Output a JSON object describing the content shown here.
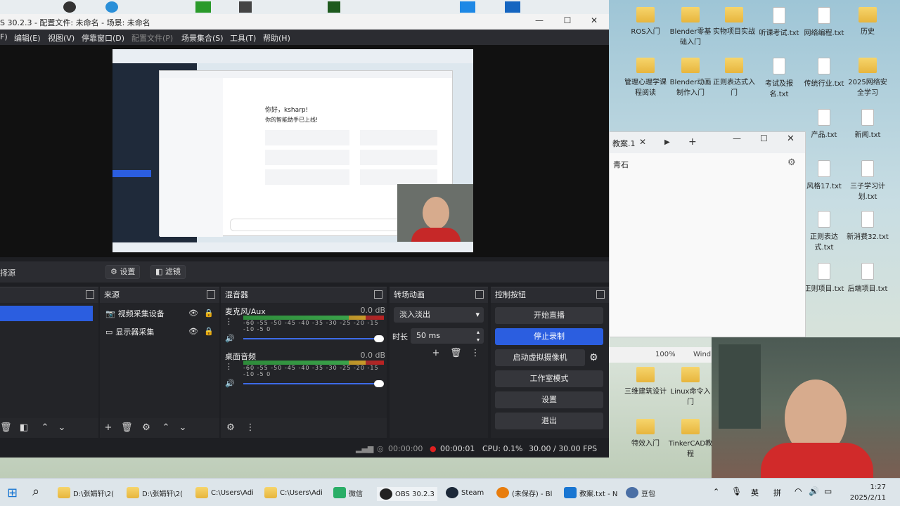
{
  "desktop_icons": [
    {
      "label": "ROS入门",
      "type": "folder"
    },
    {
      "label": "Blender零基础入门",
      "type": "folder"
    },
    {
      "label": "实物项目实战",
      "type": "folder"
    },
    {
      "label": "听课考试.txt",
      "type": "doc"
    },
    {
      "label": "网络编程.txt",
      "type": "doc"
    },
    {
      "label": "历史",
      "type": "folder"
    },
    {
      "label": "管理心理学课程阅读",
      "type": "folder"
    },
    {
      "label": "Blender动画制作入门",
      "type": "folder"
    },
    {
      "label": "正则表达式入门",
      "type": "folder"
    },
    {
      "label": "考试及报名.txt",
      "type": "doc"
    },
    {
      "label": "传统行业.txt",
      "type": "doc"
    },
    {
      "label": "2025网络安全学习",
      "type": "folder"
    },
    {
      "label": "产品.txt",
      "type": "doc"
    },
    {
      "label": "新闻.txt",
      "type": "doc"
    },
    {
      "label": "风格17.txt",
      "type": "doc"
    },
    {
      "label": "三子学习计划.txt",
      "type": "doc"
    },
    {
      "label": "正则表达式.txt",
      "type": "doc"
    },
    {
      "label": "新消费32.txt",
      "type": "doc"
    },
    {
      "label": "正则项目.txt",
      "type": "doc"
    },
    {
      "label": "后端项目.txt",
      "type": "doc"
    },
    {
      "label": "三维建筑设计",
      "type": "folder"
    },
    {
      "label": "Linux命令入门",
      "type": "folder"
    },
    {
      "label": "特效入门",
      "type": "folder"
    },
    {
      "label": "TinkerCAD教程",
      "type": "folder"
    }
  ],
  "obs": {
    "title": "S 30.2.3 - 配置文件: 未命名 - 场景: 未命名",
    "menu": [
      "F)",
      "编辑(E)",
      "视图(V)",
      "停靠窗口(D)",
      "配置文件(P)",
      "场景集合(S)",
      "工具(T)",
      "帮助(H)"
    ],
    "preview": {
      "greeting": "你好，ksharp!",
      "subtitle": "你的智能助手已上线!"
    },
    "toolbar": {
      "source_label": "择源",
      "settings": "设置",
      "filters": "滤镜"
    },
    "docks": {
      "sources": "来源",
      "mixer": "混音器",
      "transitions": "转场动画",
      "controls": "控制按钮"
    },
    "sources": [
      {
        "name": "视频采集设备",
        "icon": "camera-icon"
      },
      {
        "name": "显示器采集",
        "icon": "monitor-icon"
      }
    ],
    "mixer": [
      {
        "name": "麦克风/Aux",
        "db": "0.0 dB",
        "scale": "-60 -55 -50 -45 -40 -35 -30 -25 -20 -15 -10 -5 0",
        "volume": 1.0
      },
      {
        "name": "桌面音频",
        "db": "0.0 dB",
        "scale": "-60 -55 -50 -45 -40 -35 -30 -25 -20 -15 -10 -5 0",
        "volume": 1.0
      }
    ],
    "transitions": {
      "selected": "淡入淡出",
      "duration_label": "时长",
      "duration_value": "50 ms"
    },
    "controls": {
      "start_stream": "开始直播",
      "stop_record": "停止录制",
      "virtual_cam": "启动虚拟摄像机",
      "studio_mode": "工作室模式",
      "settings": "设置",
      "exit": "退出"
    },
    "status": {
      "stream_time": "00:00:00",
      "record_time": "00:00:01",
      "cpu": "CPU: 0.1%",
      "fps": "30.00 / 30.00 FPS"
    }
  },
  "notepad": {
    "tab": "教案.1",
    "content": "青石",
    "zoom": "100%",
    "encoding": "Wind"
  },
  "taskbar": {
    "items": [
      "D:\\张娟轩\\2(",
      "D:\\张娟轩\\2(",
      "C:\\Users\\Adi",
      "C:\\Users\\Adi",
      "微信",
      "OBS 30.2.3",
      "Steam",
      "(未保存) - Bl",
      "教案.txt - N",
      "豆包"
    ],
    "tray": [
      "英",
      "拼"
    ],
    "time": "1:27",
    "date": "2025/2/11"
  },
  "colors": {
    "accent": "#2b5ee0",
    "obs_bg": "#1e1f23",
    "record": "#e02020"
  }
}
